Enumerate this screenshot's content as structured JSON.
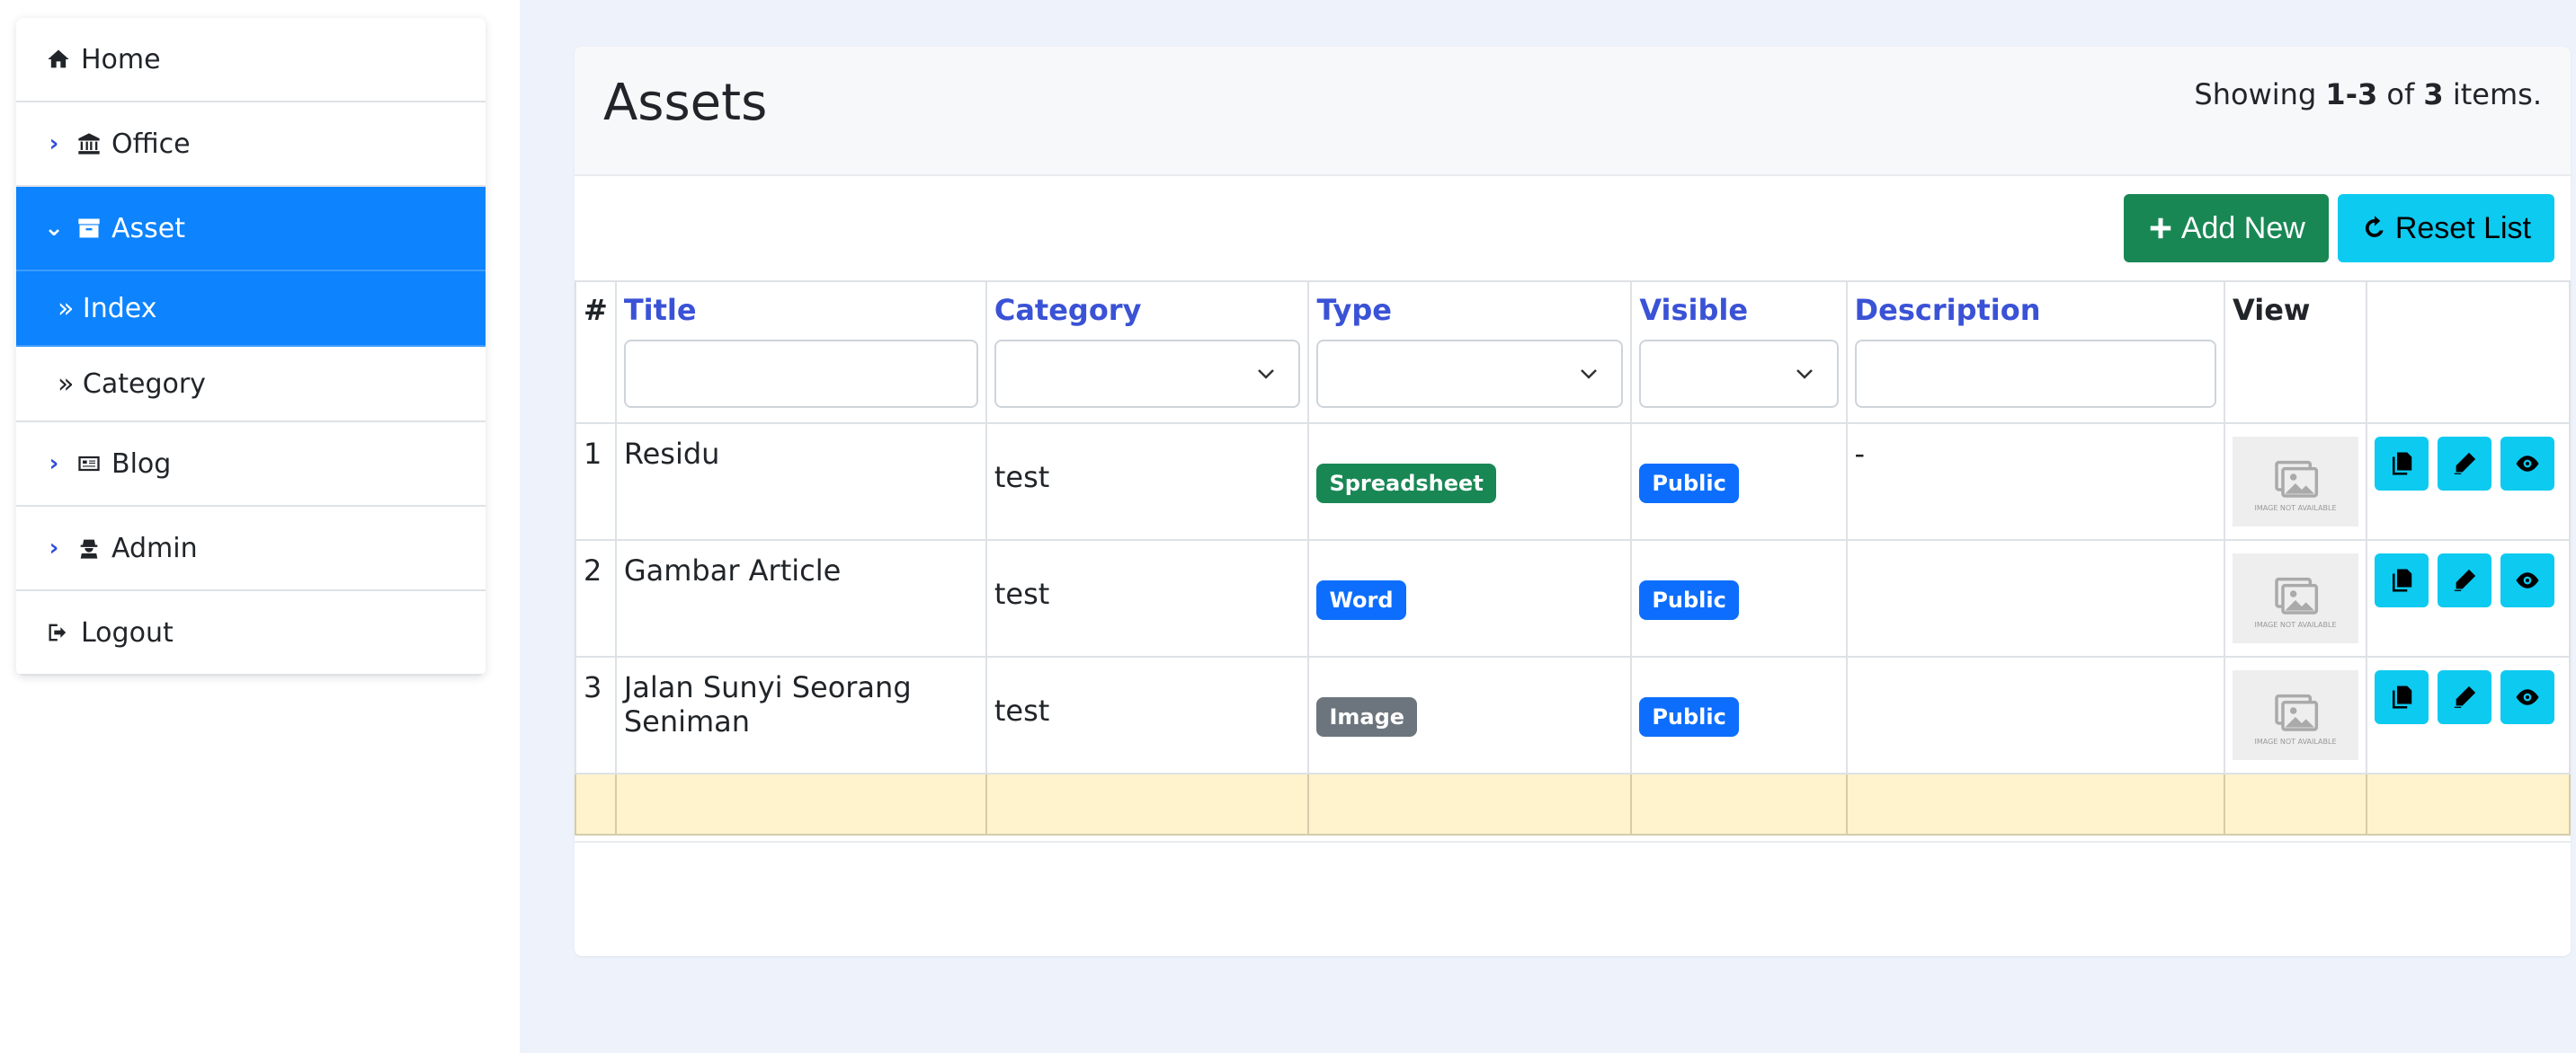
{
  "sidebar": {
    "items": [
      {
        "label": "Home",
        "icon": "home-icon",
        "chevron": "",
        "active": false,
        "sub": false
      },
      {
        "label": "Office",
        "icon": "bank-icon",
        "chevron": "›",
        "active": false,
        "sub": false
      },
      {
        "label": "Asset",
        "icon": "archive-icon",
        "chevron": "⌄",
        "active": true,
        "sub": false
      },
      {
        "label": "» Index",
        "icon": "",
        "chevron": "",
        "active": true,
        "sub": true
      },
      {
        "label": "» Category",
        "icon": "",
        "chevron": "",
        "active": false,
        "sub": true
      },
      {
        "label": "Blog",
        "icon": "newspaper-icon",
        "chevron": "›",
        "active": false,
        "sub": false
      },
      {
        "label": "Admin",
        "icon": "user-secret-icon",
        "chevron": "›",
        "active": false,
        "sub": false
      },
      {
        "label": "Logout",
        "icon": "logout-icon",
        "chevron": "",
        "active": false,
        "sub": false
      }
    ]
  },
  "page": {
    "title": "Assets",
    "summary_prefix": "Showing ",
    "summary_range": "1-3",
    "summary_of": " of ",
    "summary_total": "3",
    "summary_suffix": " items."
  },
  "toolbar": {
    "add_label": "Add New",
    "reset_label": "Reset List"
  },
  "table": {
    "headers": {
      "num": "#",
      "title": "Title",
      "category": "Category",
      "type": "Type",
      "visible": "Visible",
      "description": "Description",
      "view": "View"
    },
    "rows": [
      {
        "num": "1",
        "title": "Residu",
        "category": "test",
        "type": "Spreadsheet",
        "visible": "Public",
        "description": "-",
        "thumb_text": "IMAGE NOT AVAILABLE"
      },
      {
        "num": "2",
        "title": "Gambar Article",
        "category": "test",
        "type": "Word",
        "visible": "Public",
        "description": "",
        "thumb_text": "IMAGE NOT AVAILABLE"
      },
      {
        "num": "3",
        "title": "Jalan Sunyi Seorang Seniman",
        "category": "test",
        "type": "Image",
        "visible": "Public",
        "description": "",
        "thumb_text": "IMAGE NOT AVAILABLE"
      }
    ]
  },
  "colors": {
    "accent": "#0d83fd",
    "success": "#198754",
    "info": "#0dcaf0",
    "link": "#3a52d6",
    "badge_spreadsheet": "#198754",
    "badge_word": "#0d6efd",
    "badge_image": "#6c757d",
    "badge_public": "#0d6efd"
  }
}
